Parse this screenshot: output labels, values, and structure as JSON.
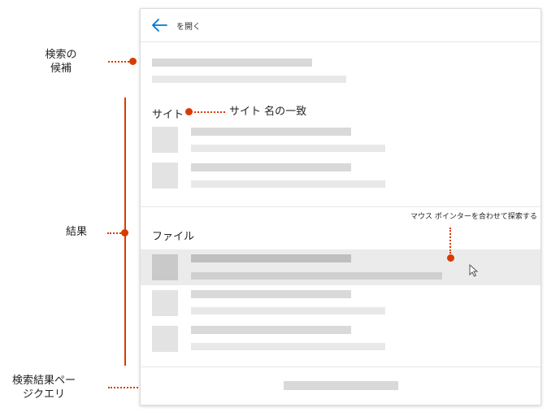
{
  "header": {
    "back_icon": "arrow-left-icon",
    "title": "を開く"
  },
  "sections": {
    "sites_title": "サイト",
    "files_title": "ファイル"
  },
  "callouts": {
    "suggestions": [
      "検索の",
      "候補"
    ],
    "site_match": "サイト 名の一致",
    "results": "結果",
    "hover": "マウス ポインターを合わせて探索する",
    "results_page": [
      "検索結果ペー",
      "ジクエリ"
    ]
  },
  "colors": {
    "accent": "#d83b01",
    "back_arrow": "#0078d4",
    "placeholder": "#d9d9d9",
    "hover_row": "#ebebeb"
  }
}
